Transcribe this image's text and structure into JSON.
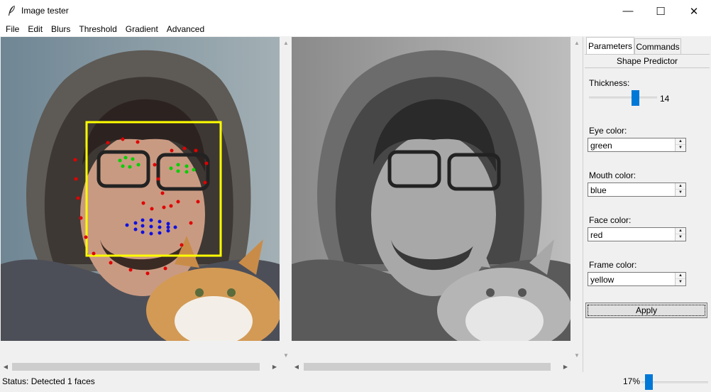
{
  "window": {
    "title": "Image tester",
    "min_glyph": "—",
    "max_glyph": "☐",
    "close_glyph": "✕"
  },
  "menu": [
    "File",
    "Edit",
    "Blurs",
    "Threshold",
    "Gradient",
    "Advanced"
  ],
  "panel": {
    "tabs": [
      "Parameters",
      "Commands"
    ],
    "active_tab": "Parameters",
    "section_title": "Shape Predictor",
    "thickness": {
      "label": "Thickness:",
      "value": 14
    },
    "fields": [
      {
        "label": "Eye color:",
        "value": "green"
      },
      {
        "label": "Mouth color:",
        "value": "blue"
      },
      {
        "label": "Face color:",
        "value": "red"
      },
      {
        "label": "Frame color:",
        "value": "yellow"
      }
    ],
    "apply_label": "Apply"
  },
  "status": {
    "text": "Status: Detected 1 faces",
    "zoom_label": "17%"
  },
  "colors": {
    "accent": "#0078d7",
    "frame": "#ffff00",
    "eye_points": "#00d000",
    "mouth_points": "#1010e0",
    "face_points": "#e00000"
  },
  "icons": {
    "app": "feather-icon",
    "scroll_up": "triangle-up-icon",
    "scroll_down": "triangle-down-icon",
    "scroll_left": "triangle-left-icon",
    "scroll_right": "triangle-right-icon"
  }
}
